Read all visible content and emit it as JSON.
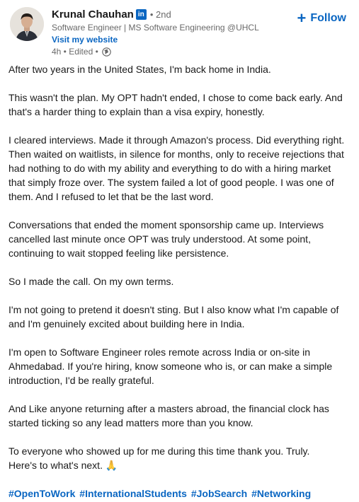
{
  "author": {
    "name": "Krunal Chauhan",
    "badge": "in",
    "degree": "• 2nd",
    "headline": "Software Engineer | MS Software Engineering @UHCL",
    "website_link": "Visit my website",
    "timestamp": "4h • Edited •",
    "visibility_icon": "globe-icon"
  },
  "follow_label": "Follow",
  "paragraphs": [
    "After two years in the United States, I'm back home in India.",
    "This wasn't the plan. My OPT hadn't ended, I chose to come back early. And that's a harder thing to explain than a visa expiry, honestly.",
    "I cleared interviews. Made it through Amazon's process. Did everything right. Then waited on waitlists, in silence for months, only to receive rejections that had nothing to do with my ability and everything to do with a hiring market that simply froze over. The system failed a lot of good people. I was one of them. And I refused to let that be the last word.",
    "Conversations that ended the moment sponsorship came up. Interviews cancelled last minute once OPT was truly understood. At some point, continuing to wait stopped feeling like persistence.",
    "So I made the call. On my own terms.",
    "I'm not going to pretend it doesn't sting. But I also know what I'm capable of and I'm genuinely excited about building here in India.",
    "I'm open to Software Engineer roles remote across India or on-site in Ahmedabad. If you're hiring, know someone who is, or can make a simple introduction, I'd be really grateful.",
    "And Like anyone returning after a masters abroad, the financial clock has started ticking so any lead matters more than you know.",
    "To everyone who showed up for me during this time thank you. Truly.\nHere's to what's next. 🙏"
  ],
  "hashtags": [
    "#OpenToWork",
    "#InternationalStudents",
    "#JobSearch",
    "#Networking"
  ],
  "colors": {
    "link": "#0a66c2",
    "text": "#191919",
    "muted": "#666666"
  }
}
